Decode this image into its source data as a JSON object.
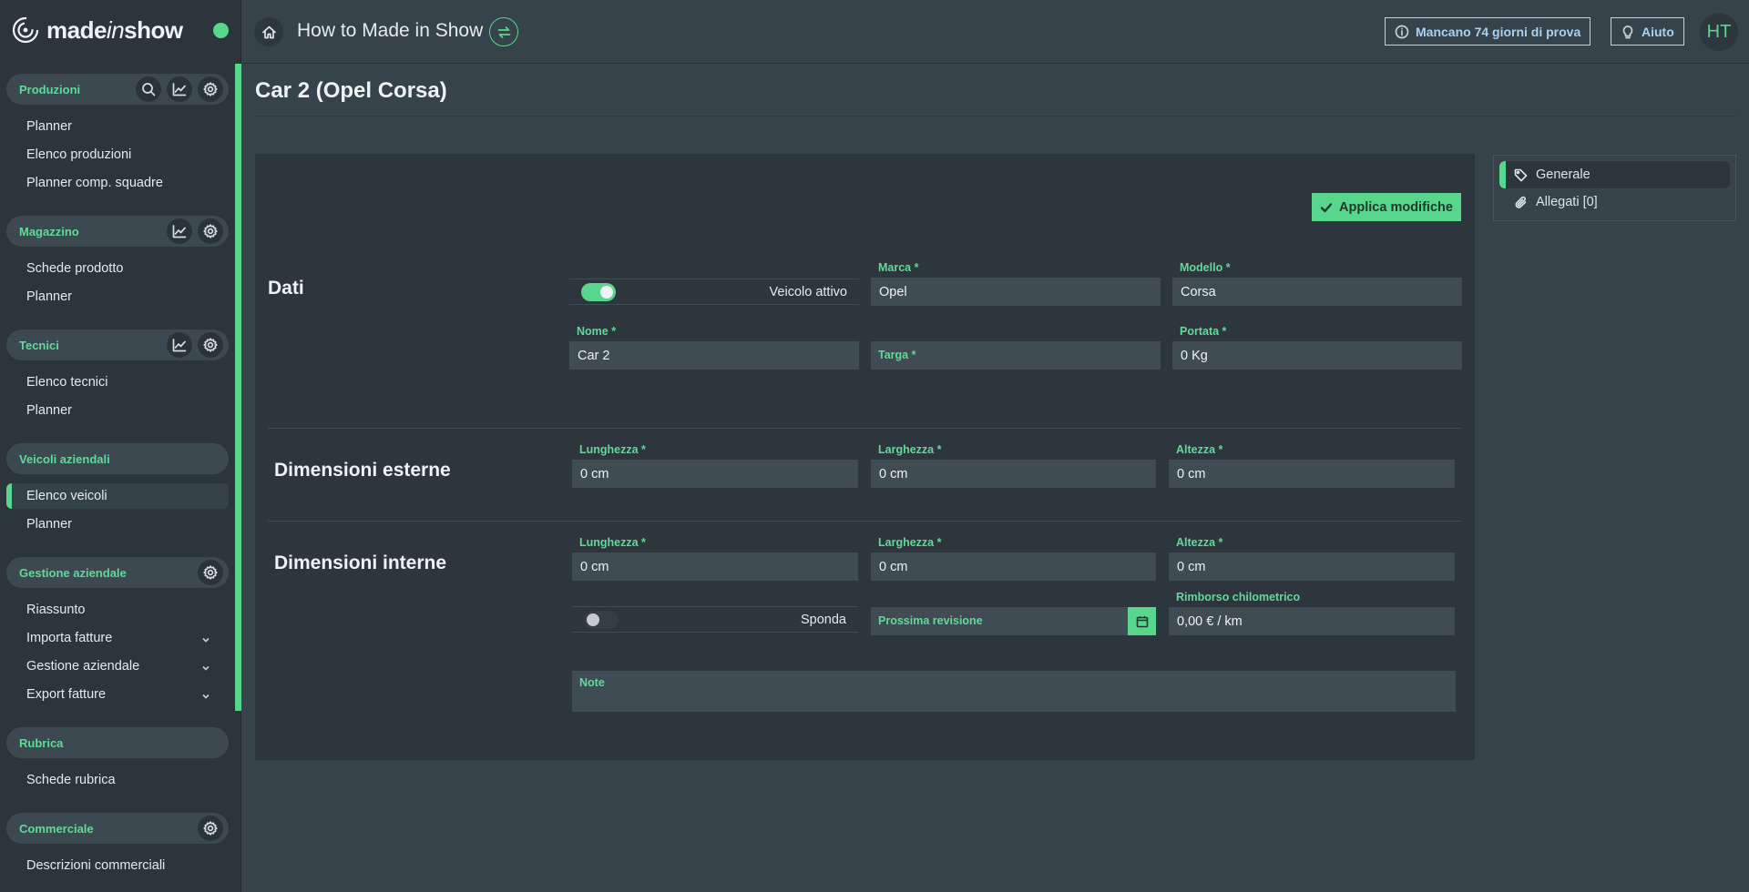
{
  "brand": {
    "pre": "made",
    "mid": "in",
    "post": "show"
  },
  "colors": {
    "accent": "#58d68d",
    "background": "#36434a",
    "sidebar": "#2b353b",
    "card": "#2c363c",
    "field": "#404c53"
  },
  "sidebar": {
    "sections": [
      {
        "title": "Produzioni",
        "items": [
          "Planner",
          "Elenco produzioni",
          "Planner comp. squadre"
        ]
      },
      {
        "title": "Magazzino",
        "items": [
          "Schede prodotto",
          "Planner"
        ]
      },
      {
        "title": "Tecnici",
        "items": [
          "Elenco tecnici",
          "Planner"
        ]
      },
      {
        "title": "Veicoli aziendali",
        "items": [
          "Elenco veicoli",
          "Planner"
        ],
        "active_item": "Elenco veicoli"
      },
      {
        "title": "Gestione aziendale",
        "items": [
          "Riassunto",
          "Importa fatture",
          "Gestione aziendale",
          "Export fatture"
        ]
      },
      {
        "title": "Rubrica",
        "items": [
          "Schede rubrica"
        ]
      },
      {
        "title": "Commerciale",
        "items": [
          "Descrizioni commerciali"
        ]
      }
    ]
  },
  "topbar": {
    "title": "How to Made in Show",
    "trial": "Mancano 74 giorni di prova",
    "help": "Aiuto",
    "avatar": "HT"
  },
  "page": {
    "title": "Car 2 (Opel Corsa)"
  },
  "form": {
    "apply": "Applica modifiche",
    "dati": {
      "title": "Dati",
      "active_toggle": {
        "label": "Veicolo attivo",
        "on": true
      },
      "marca": {
        "label": "Marca *",
        "value": "Opel"
      },
      "modello": {
        "label": "Modello *",
        "value": "Corsa"
      },
      "nome": {
        "label": "Nome *",
        "value": "Car 2"
      },
      "targa": {
        "label": "Targa *",
        "value": ""
      },
      "portata": {
        "label": "Portata *",
        "value": "0 Kg"
      }
    },
    "esterne": {
      "title": "Dimensioni esterne",
      "lunghezza": {
        "label": "Lunghezza *",
        "value": "0 cm"
      },
      "larghezza": {
        "label": "Larghezza *",
        "value": "0 cm"
      },
      "altezza": {
        "label": "Altezza *",
        "value": "0 cm"
      }
    },
    "interne": {
      "title": "Dimensioni interne",
      "lunghezza": {
        "label": "Lunghezza *",
        "value": "0 cm"
      },
      "larghezza": {
        "label": "Larghezza *",
        "value": "0 cm"
      },
      "altezza": {
        "label": "Altezza *",
        "value": "0 cm"
      },
      "sponda": {
        "label": "Sponda",
        "on": false
      },
      "revisione": {
        "label": "Prossima revisione",
        "value": ""
      },
      "rimborso": {
        "label": "Rimborso chilometrico",
        "value": "0,00 € / km"
      },
      "note": {
        "label": "Note",
        "value": ""
      }
    }
  },
  "tabs": [
    {
      "label": "Generale",
      "icon": "tag-icon"
    },
    {
      "label": "Allegati [0]",
      "icon": "paperclip-icon"
    }
  ]
}
